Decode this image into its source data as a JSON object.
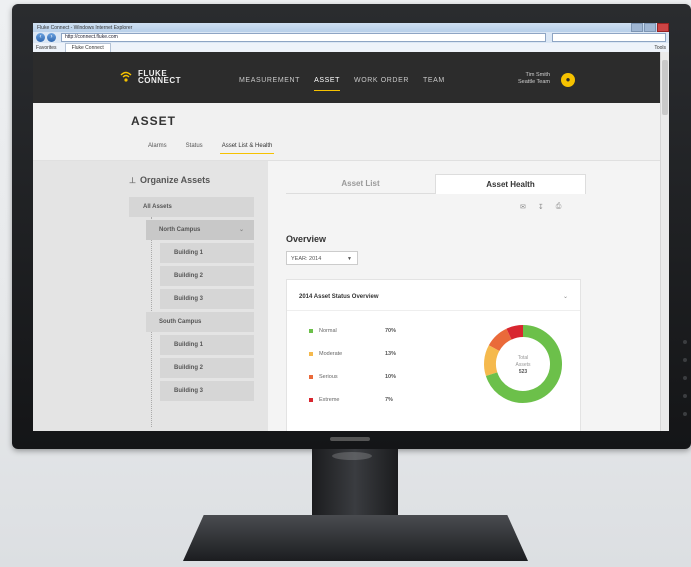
{
  "browser": {
    "window_title": "Fluke Connect - Windows Internet Explorer",
    "url": "http://connect.fluke.com",
    "favorites_label": "Favorites",
    "tab_label": "Fluke Connect",
    "tools_label": "Tools"
  },
  "app": {
    "logo_line1": "FLUKE",
    "logo_line2": "CONNECT",
    "nav": [
      "MEASUREMENT",
      "ASSET",
      "WORK ORDER",
      "TEAM"
    ],
    "active_nav": "ASSET",
    "user_name": "Tim Smith",
    "user_team": "Seattle Team",
    "accent": "#f6c200"
  },
  "page": {
    "title": "ASSET",
    "subtabs": [
      "Alarms",
      "Status",
      "Asset List & Health"
    ],
    "active_subtab": "Asset List & Health"
  },
  "sidebar": {
    "title": "Organize Assets",
    "all_assets": "All Assets",
    "groups": [
      {
        "label": "North Campus",
        "children": [
          "Building 1",
          "Building 2",
          "Building 3"
        ]
      },
      {
        "label": "South Campus",
        "children": [
          "Building 1",
          "Building 2",
          "Building 3"
        ]
      }
    ]
  },
  "main": {
    "tabs": [
      "Asset List",
      "Asset Health"
    ],
    "active_tab": "Asset Health",
    "overview_title": "Overview",
    "year_select": "YEAR: 2014",
    "card_title": "2014 Asset Status Overview",
    "total_label_line1": "Total",
    "total_label_line2": "Assets",
    "total_value": "523",
    "status": [
      {
        "label": "Normal",
        "pct": "70%",
        "value": 70,
        "color": "#6cc04a"
      },
      {
        "label": "Moderate",
        "pct": "13%",
        "value": 13,
        "color": "#f5b94d"
      },
      {
        "label": "Serious",
        "pct": "10%",
        "value": 10,
        "color": "#ea6a3a"
      },
      {
        "label": "Extreme",
        "pct": "7%",
        "value": 7,
        "color": "#d8262f"
      }
    ]
  }
}
